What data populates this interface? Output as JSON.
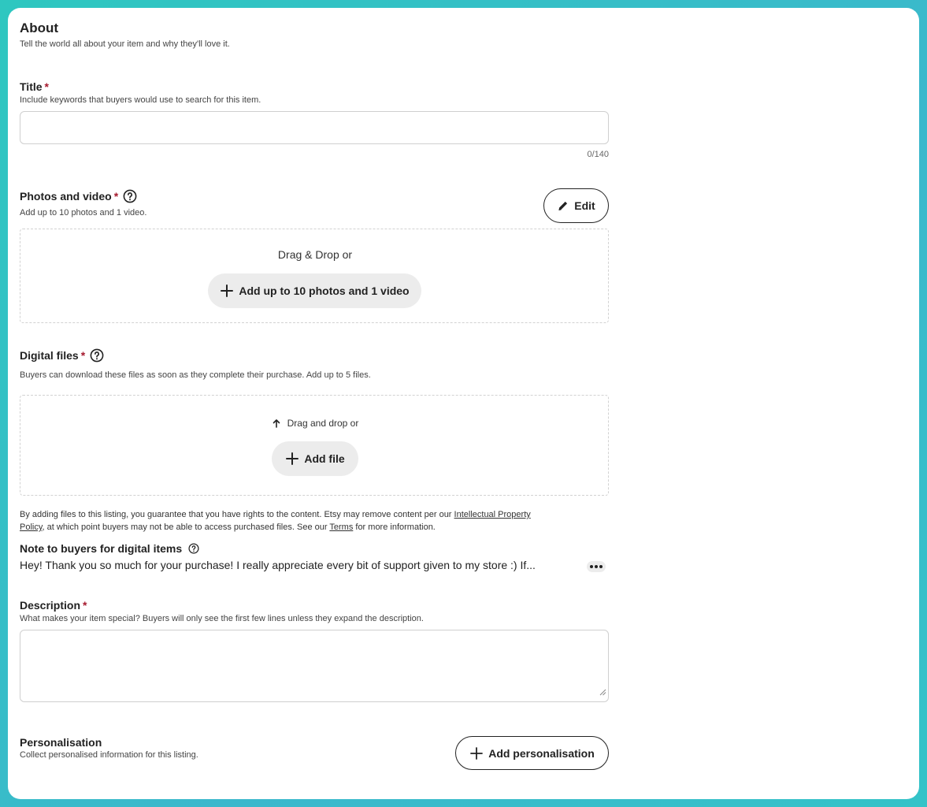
{
  "about": {
    "heading": "About",
    "subheading": "Tell the world all about your item and why they'll love it."
  },
  "title_field": {
    "label": "Title",
    "required_mark": "*",
    "helper": "Include keywords that buyers would use to search for this item.",
    "value": "",
    "placeholder": "",
    "counter": "0/140"
  },
  "photos": {
    "label": "Photos and video",
    "required_mark": "*",
    "helper": "Add up to 10 photos and 1 video.",
    "edit_label": "Edit",
    "drop_text": "Drag & Drop or",
    "add_label": "Add up to 10 photos and 1 video"
  },
  "digital_files": {
    "label": "Digital files",
    "required_mark": "*",
    "helper": "Buyers can download these files as soon as they complete their purchase. Add up to 5 files.",
    "drop_text": "Drag and drop or",
    "add_label": "Add file",
    "legal_part1": "By adding files to this listing, you guarantee that you have rights to the content. Etsy may remove content per our ",
    "legal_link1_line1": "Intellectual Property",
    "legal_link1_line2": "Policy",
    "legal_part2": ", at which point buyers may not be able to access purchased files. See our ",
    "legal_link2": "Terms",
    "legal_part3": " for more information."
  },
  "note_to_buyers": {
    "label": "Note to buyers for digital items",
    "text": "Hey! Thank you so much for your purchase! I really appreciate every bit of support given to my store :) If..."
  },
  "description": {
    "label": "Description",
    "required_mark": "*",
    "helper": "What makes your item special? Buyers will only see the first few lines unless they expand the description.",
    "value": ""
  },
  "personalisation": {
    "label": "Personalisation",
    "helper": "Collect personalised information for this listing.",
    "add_label": "Add personalisation"
  }
}
